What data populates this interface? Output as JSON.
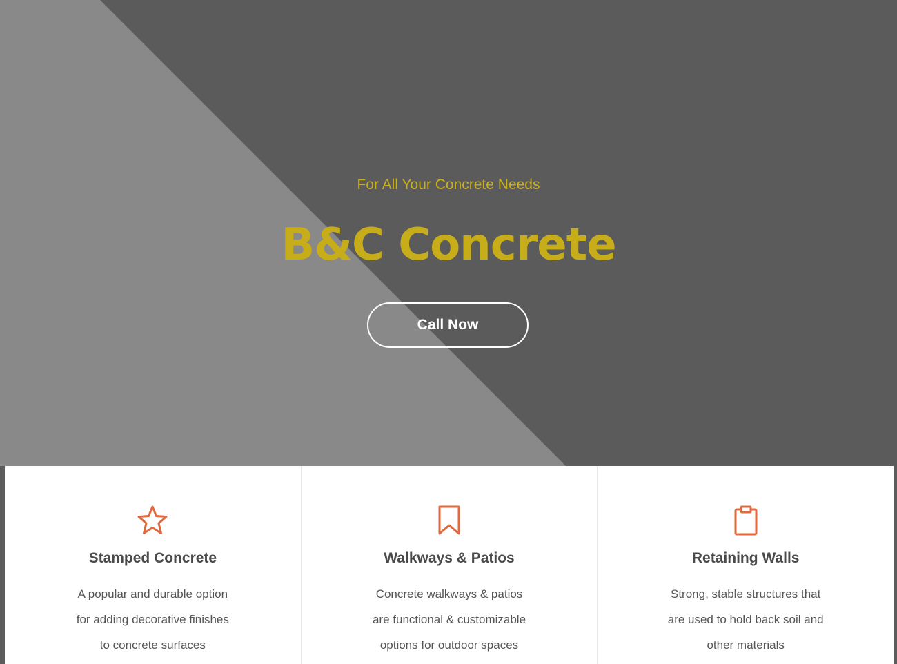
{
  "hero": {
    "tagline": "For All Your Concrete Needs",
    "title": "B&C Concrete",
    "cta_label": "Call Now"
  },
  "services": [
    {
      "icon": "star-icon",
      "title": "Stamped Concrete",
      "lines": [
        "A popular and durable option",
        "for adding decorative finishes",
        "to concrete surfaces"
      ]
    },
    {
      "icon": "bookmark-icon",
      "title": "Walkways & Patios",
      "lines": [
        "Concrete walkways & patios",
        "are functional & customizable",
        "options for outdoor spaces"
      ]
    },
    {
      "icon": "clipboard-icon",
      "title": "Retaining Walls",
      "lines": [
        "Strong, stable structures that",
        "are used to hold back soil and",
        "other materials"
      ]
    }
  ],
  "colors": {
    "accent_gold": "#c7ad1a",
    "icon_orange": "#e06a3e",
    "hero_dark": "#5b5b5b",
    "hero_light": "#898989"
  }
}
